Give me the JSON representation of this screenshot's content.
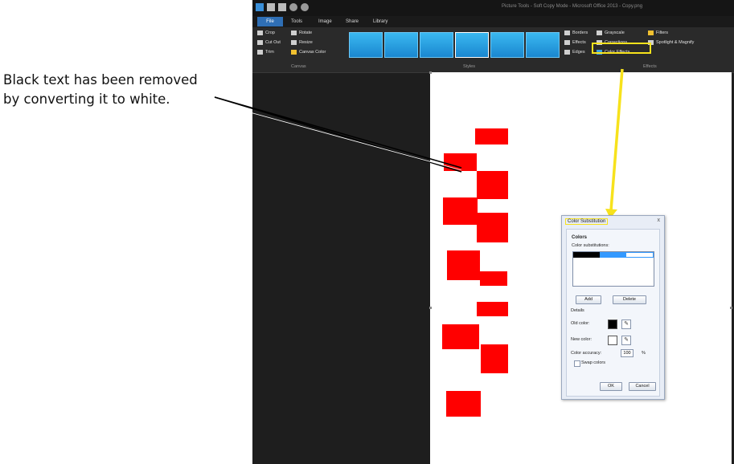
{
  "callout": {
    "line1": "Black text has been removed",
    "line2": "by converting it to white."
  },
  "app": {
    "title": "Picture Tools - Soft Copy Mode - Microsoft Office 2013 - Copy.png",
    "tabs": [
      "File",
      "Tools",
      "Image",
      "Share",
      "Library"
    ],
    "ribbon": {
      "crop": "Crop",
      "cutout": "Cut Out",
      "trim": "Trim",
      "rotate": "Rotate",
      "resize": "Resize",
      "canvas_color": "Canvas Color",
      "group_canvas": "Canvas",
      "group_styles": "Styles",
      "borders": "Borders",
      "effects": "Effects",
      "edges": "Edges",
      "grayscale": "Grayscale",
      "corrections": "Corrections",
      "color_effects": "Color Effects",
      "filters": "Filters",
      "spotlight": "Spotlight & Magnify",
      "group_effects": "Effects"
    }
  },
  "dialog": {
    "title": "Color Substitution",
    "close": "x",
    "section": "Colors",
    "subs_label": "Color substitutions:",
    "add": "Add",
    "delete": "Delete",
    "details": "Details",
    "old_color": "Old color:",
    "new_color": "New color:",
    "accuracy_label": "Color accuracy:",
    "accuracy_value": "100",
    "percent": "%",
    "swap": "Swap colors",
    "ok": "OK",
    "cancel": "Cancel",
    "colors": {
      "old": "#000000",
      "new": "#ffffff",
      "selection": "#3399ff"
    }
  },
  "colors": {
    "highlight": "#f7e21c",
    "redact": "#ff0000",
    "app_bg": "#1e1e1e"
  }
}
